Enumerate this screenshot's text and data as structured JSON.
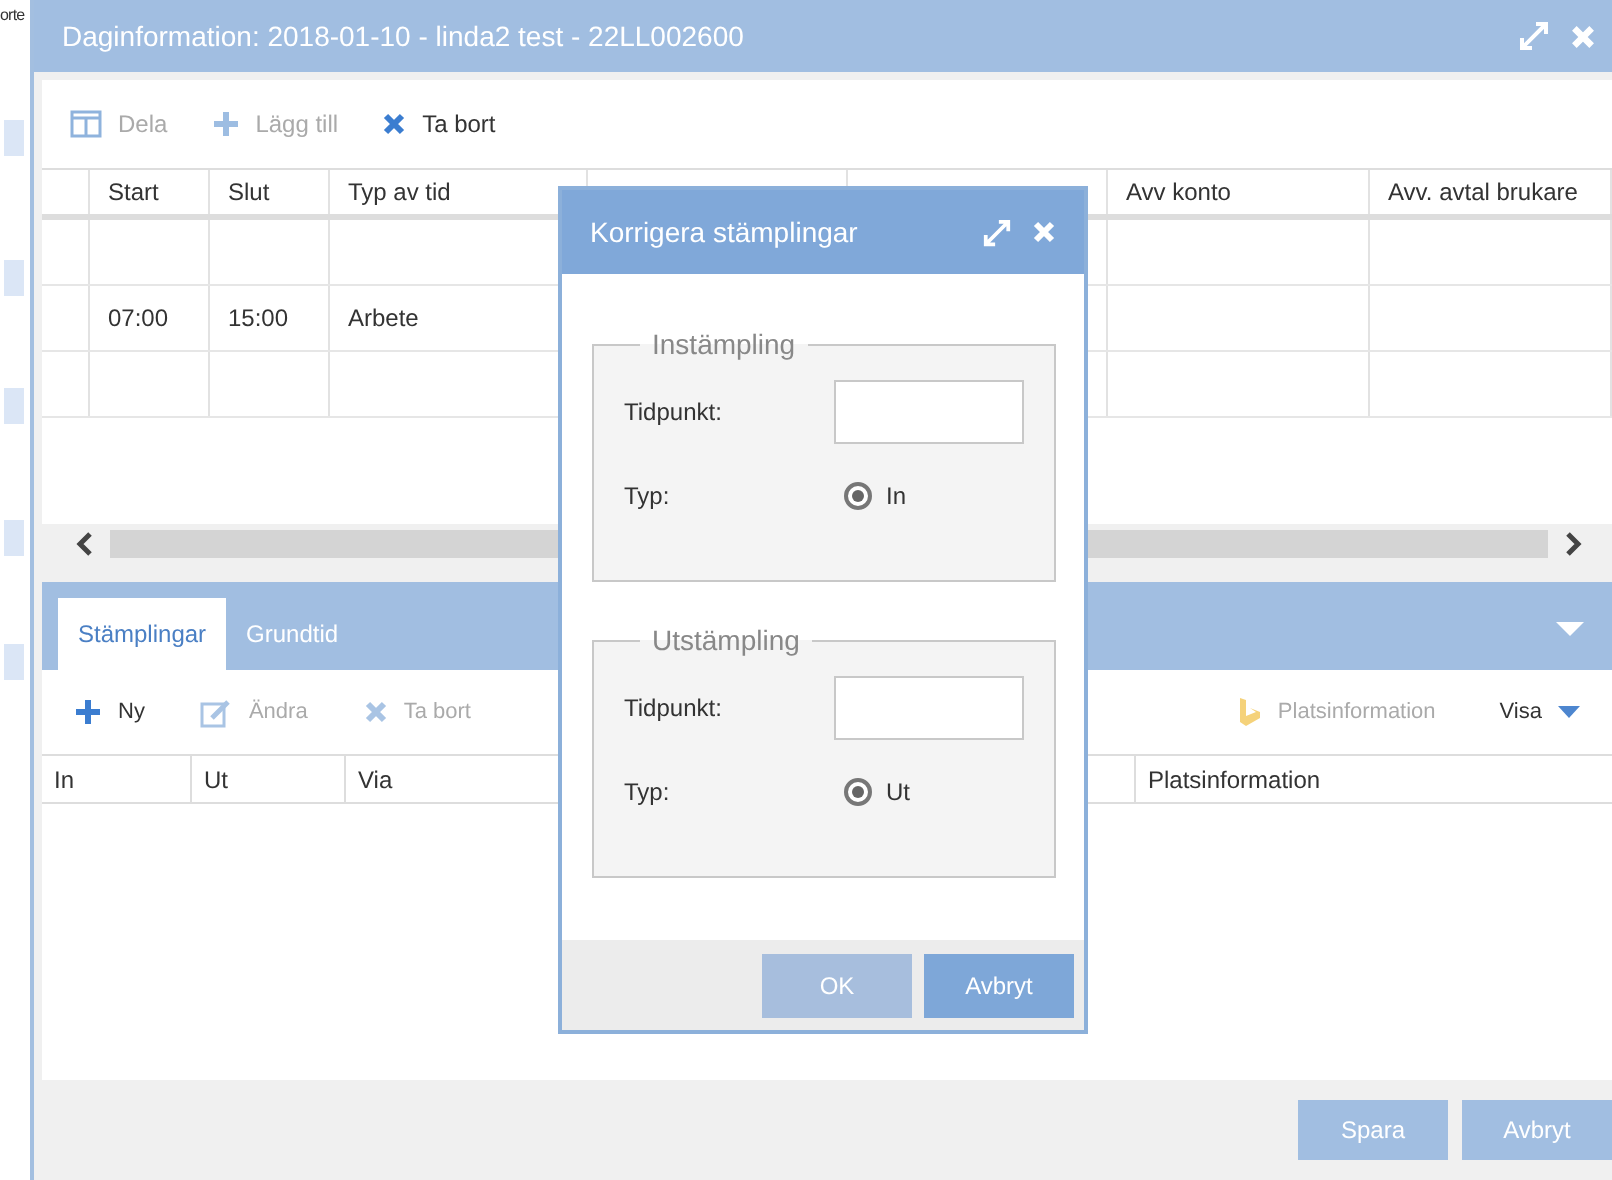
{
  "background_page": {
    "text": "orte"
  },
  "dialog": {
    "title": "Daginformation: 2018-01-10 - linda2 test - 22LL002600",
    "toolbar": [
      {
        "label": "Dela",
        "kind": "columns",
        "disabled": true
      },
      {
        "label": "Lägg till",
        "kind": "add",
        "disabled": true
      },
      {
        "label": "Ta bort",
        "kind": "delete",
        "disabled": false
      }
    ],
    "table": {
      "columns": [
        "Start",
        "Slut",
        "Typ av tid",
        "Avv konto",
        "Avv. avtal brukare"
      ],
      "rows": [
        {
          "start": "07:00",
          "end": "15:00",
          "type": "Arbete"
        }
      ]
    },
    "tabs": [
      {
        "label": "Stämplingar",
        "selected": true
      },
      {
        "label": "Grundtid",
        "selected": false
      }
    ],
    "stamp_toolbar": [
      {
        "label": "Ny",
        "kind": "add",
        "disabled": false
      },
      {
        "label": "Ändra",
        "kind": "edit",
        "disabled": true
      },
      {
        "label": "Ta bort",
        "kind": "delete",
        "disabled": true
      }
    ],
    "location_button": {
      "label": "Platsinformation",
      "disabled": true
    },
    "view_menu": {
      "label": "Visa"
    },
    "stamp_columns": [
      "In",
      "Ut",
      "Via",
      "Platsinformation"
    ],
    "buttons": [
      "Spara",
      "Avbryt"
    ]
  },
  "modal": {
    "title": "Korrigera stämplingar",
    "groups": [
      {
        "legend": "Instämpling",
        "time_label": "Tidpunkt:",
        "type_label": "Typ:",
        "radio": "In",
        "checked": true
      },
      {
        "legend": "Utstämpling",
        "time_label": "Tidpunkt:",
        "type_label": "Typ:",
        "radio": "Ut",
        "checked": true
      }
    ],
    "buttons": [
      {
        "label": "OK",
        "disabled": true
      },
      {
        "label": "Avbryt",
        "disabled": false
      }
    ]
  }
}
